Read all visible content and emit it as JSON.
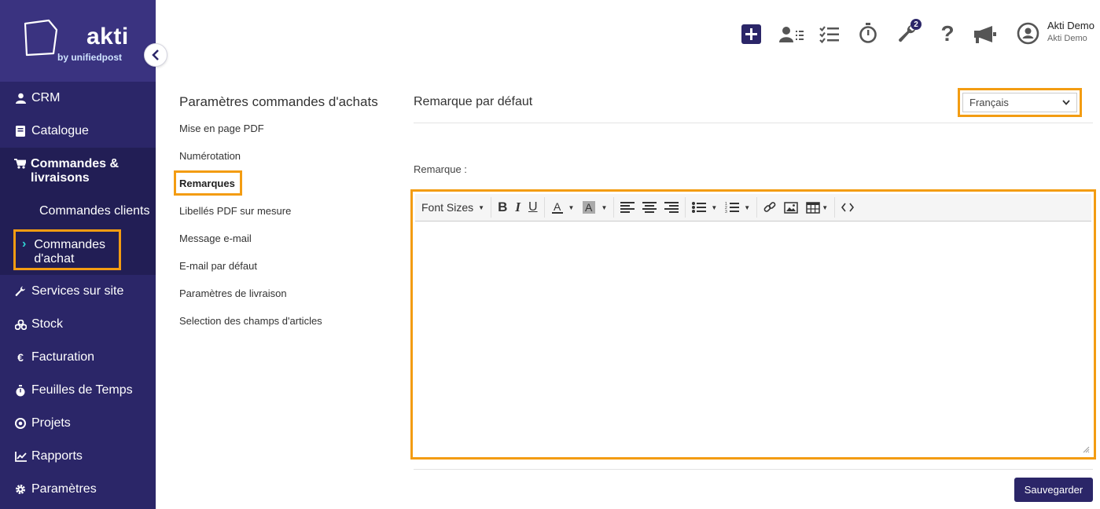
{
  "brand": {
    "name": "akti",
    "tagline": "by unifiedpost"
  },
  "sidebar": {
    "items": [
      {
        "label": "CRM",
        "icon": "user-icon"
      },
      {
        "label": "Catalogue",
        "icon": "book-icon"
      },
      {
        "label": "Commandes & livraisons",
        "icon": "cart-icon"
      },
      {
        "label": "Services sur site",
        "icon": "wrench-icon"
      },
      {
        "label": "Stock",
        "icon": "cubes-icon"
      },
      {
        "label": "Facturation",
        "icon": "euro-icon"
      },
      {
        "label": "Feuilles de Temps",
        "icon": "stopwatch-icon"
      },
      {
        "label": "Projets",
        "icon": "target-icon"
      },
      {
        "label": "Rapports",
        "icon": "chart-icon"
      },
      {
        "label": "Paramètres",
        "icon": "gear-icon"
      }
    ],
    "sub_items": [
      {
        "label": "Commandes clients"
      },
      {
        "label": "Commandes d'achat"
      }
    ]
  },
  "topbar": {
    "badge_count": "2",
    "user_name": "Akti Demo",
    "user_company": "Akti Demo"
  },
  "settings": {
    "title": "Paramètres commandes d'achats",
    "links": [
      "Mise en page PDF",
      "Numérotation",
      "Remarques",
      "Libellés PDF sur mesure",
      "Message e-mail",
      "E-mail par défaut",
      "Paramètres de livraison",
      "Selection des champs d'articles"
    ]
  },
  "main": {
    "section_title": "Remarque par défaut",
    "language_selected": "Français",
    "remark_label": "Remarque :",
    "toolbar": {
      "font_sizes": "Font Sizes"
    },
    "save_label": "Sauvegarder"
  },
  "colors": {
    "sidebar_bg": "#2b2668",
    "brand_bg": "#3a3380",
    "highlight": "#f39c12",
    "primary": "#2b2668",
    "accent": "#2fd4d4"
  }
}
